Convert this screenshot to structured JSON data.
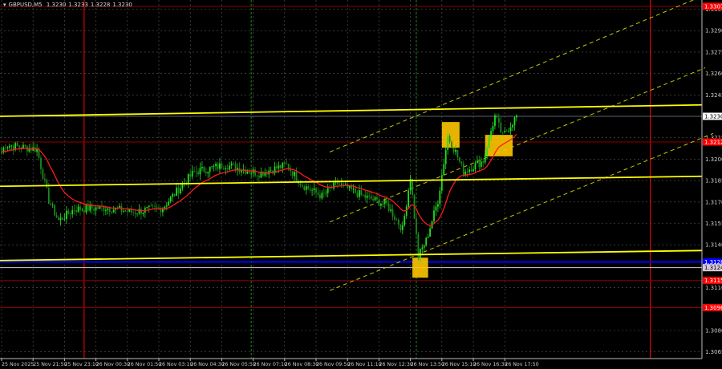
{
  "header": {
    "symbol": "GBPUSD,M5",
    "ohlc": [
      "1.3230",
      "1.3233",
      "1.3228",
      "1.3230"
    ]
  },
  "colors": {
    "background": "#000000",
    "grid": "#5a5a5a",
    "bull": "#22dd22",
    "bear": "#1a8a1a",
    "ma": "#ff1a1a",
    "level": "#ffff00",
    "channel": "#c8c800",
    "box": "#ffc800",
    "blue": "#0000ff",
    "red_line": "#8b0000"
  },
  "chart_data": {
    "type": "candlestick",
    "title": "GBPUSD,M5",
    "ylim": [
      1.3058,
      1.3312
    ],
    "yticks": [
      "1.3305",
      "1.3290",
      "1.3275",
      "1.3260",
      "1.3245",
      "1.3215",
      "1.3200",
      "1.3185",
      "1.3170",
      "1.3155",
      "1.3140",
      "1.3110",
      "1.3080",
      "1.3065"
    ],
    "xticks": [
      "25 Nov 2025",
      "25 Nov 21:50",
      "25 Nov 23:10",
      "26 Nov 00:30",
      "26 Nov 01:50",
      "26 Nov 03:10",
      "26 Nov 04:30",
      "26 Nov 05:50",
      "26 Nov 07:10",
      "26 Nov 08:30",
      "26 Nov 09:50",
      "26 Nov 11:10",
      "26 Nov 12:30",
      "26 Nov 13:50",
      "26 Nov 15:10",
      "26 Nov 16:30",
      "26 Nov 17:50"
    ],
    "approx_close_path": [
      [
        0,
        1.3205
      ],
      [
        2,
        1.321
      ],
      [
        18,
        1.3207
      ],
      [
        24,
        1.3171
      ],
      [
        29,
        1.3157
      ],
      [
        37,
        1.3165
      ],
      [
        53,
        1.3166
      ],
      [
        67,
        1.3163
      ],
      [
        82,
        1.3166
      ],
      [
        90,
        1.3179
      ],
      [
        98,
        1.3191
      ],
      [
        114,
        1.3196
      ],
      [
        131,
        1.319
      ],
      [
        145,
        1.3196
      ],
      [
        153,
        1.3182
      ],
      [
        163,
        1.3174
      ],
      [
        171,
        1.3183
      ],
      [
        184,
        1.3174
      ],
      [
        196,
        1.3168
      ],
      [
        204,
        1.3151
      ],
      [
        208,
        1.3188
      ],
      [
        212,
        1.3132
      ],
      [
        216,
        1.3143
      ],
      [
        222,
        1.3171
      ],
      [
        227,
        1.3216
      ],
      [
        231,
        1.3205
      ],
      [
        235,
        1.3191
      ],
      [
        245,
        1.3199
      ],
      [
        251,
        1.323
      ],
      [
        255,
        1.3216
      ],
      [
        262,
        1.323
      ]
    ],
    "price_labels": [
      {
        "text": "1.3307",
        "price": 1.3307,
        "bg": "#ff0000",
        "fg": "#ffffff"
      },
      {
        "text": "1.3230",
        "price": 1.323,
        "bg": "#ffffff",
        "fg": "#000000"
      },
      {
        "text": "1.3212",
        "price": 1.3212,
        "bg": "#ff0000",
        "fg": "#ffffff"
      },
      {
        "text": "1.3128",
        "price": 1.3128,
        "bg": "#0000ff",
        "fg": "#ffffff"
      },
      {
        "text": "1.3124",
        "price": 1.3124,
        "bg": "#d8c8d8",
        "fg": "#000000"
      },
      {
        "text": "1.3115",
        "price": 1.3115,
        "bg": "#ff0000",
        "fg": "#ffffff"
      },
      {
        "text": "1.3096",
        "price": 1.3096,
        "bg": "#ff0000",
        "fg": "#ffffff"
      }
    ],
    "horizontal_lines": [
      {
        "price": 1.3307,
        "color": "#8b0000"
      },
      {
        "price": 1.3212,
        "color": "#8b0000"
      },
      {
        "price": 1.3115,
        "color": "#8b0000"
      },
      {
        "price": 1.3096,
        "color": "#8b0000"
      },
      {
        "price": 1.3128,
        "color": "#0000ff"
      },
      {
        "price": 1.3124,
        "color": "#d8c8d8"
      },
      {
        "price": 1.323,
        "color": "#5a6070"
      }
    ],
    "trend_levels": [
      [
        1.323,
        1.3238
      ],
      [
        1.3181,
        1.3188
      ],
      [
        1.3129,
        1.3136
      ]
    ],
    "channel": [
      [
        167,
        1.3205,
        358,
        1.3315
      ],
      [
        167,
        1.3156,
        358,
        1.3264
      ],
      [
        167,
        1.3108,
        362,
        1.3218
      ]
    ],
    "vertical_lines": [
      {
        "bar": 42,
        "color": "#ff0000"
      },
      {
        "bar": 127,
        "color": "#1a8a1a"
      },
      {
        "bar": 211,
        "color": "#1a8a1a"
      },
      {
        "bar": 330,
        "color": "#ff0000"
      }
    ],
    "signal_boxes": [
      [
        209,
        217,
        1.3131,
        1.3117
      ],
      [
        224,
        233,
        1.3226,
        1.3208
      ],
      [
        246,
        260,
        1.3217,
        1.3202
      ]
    ]
  }
}
